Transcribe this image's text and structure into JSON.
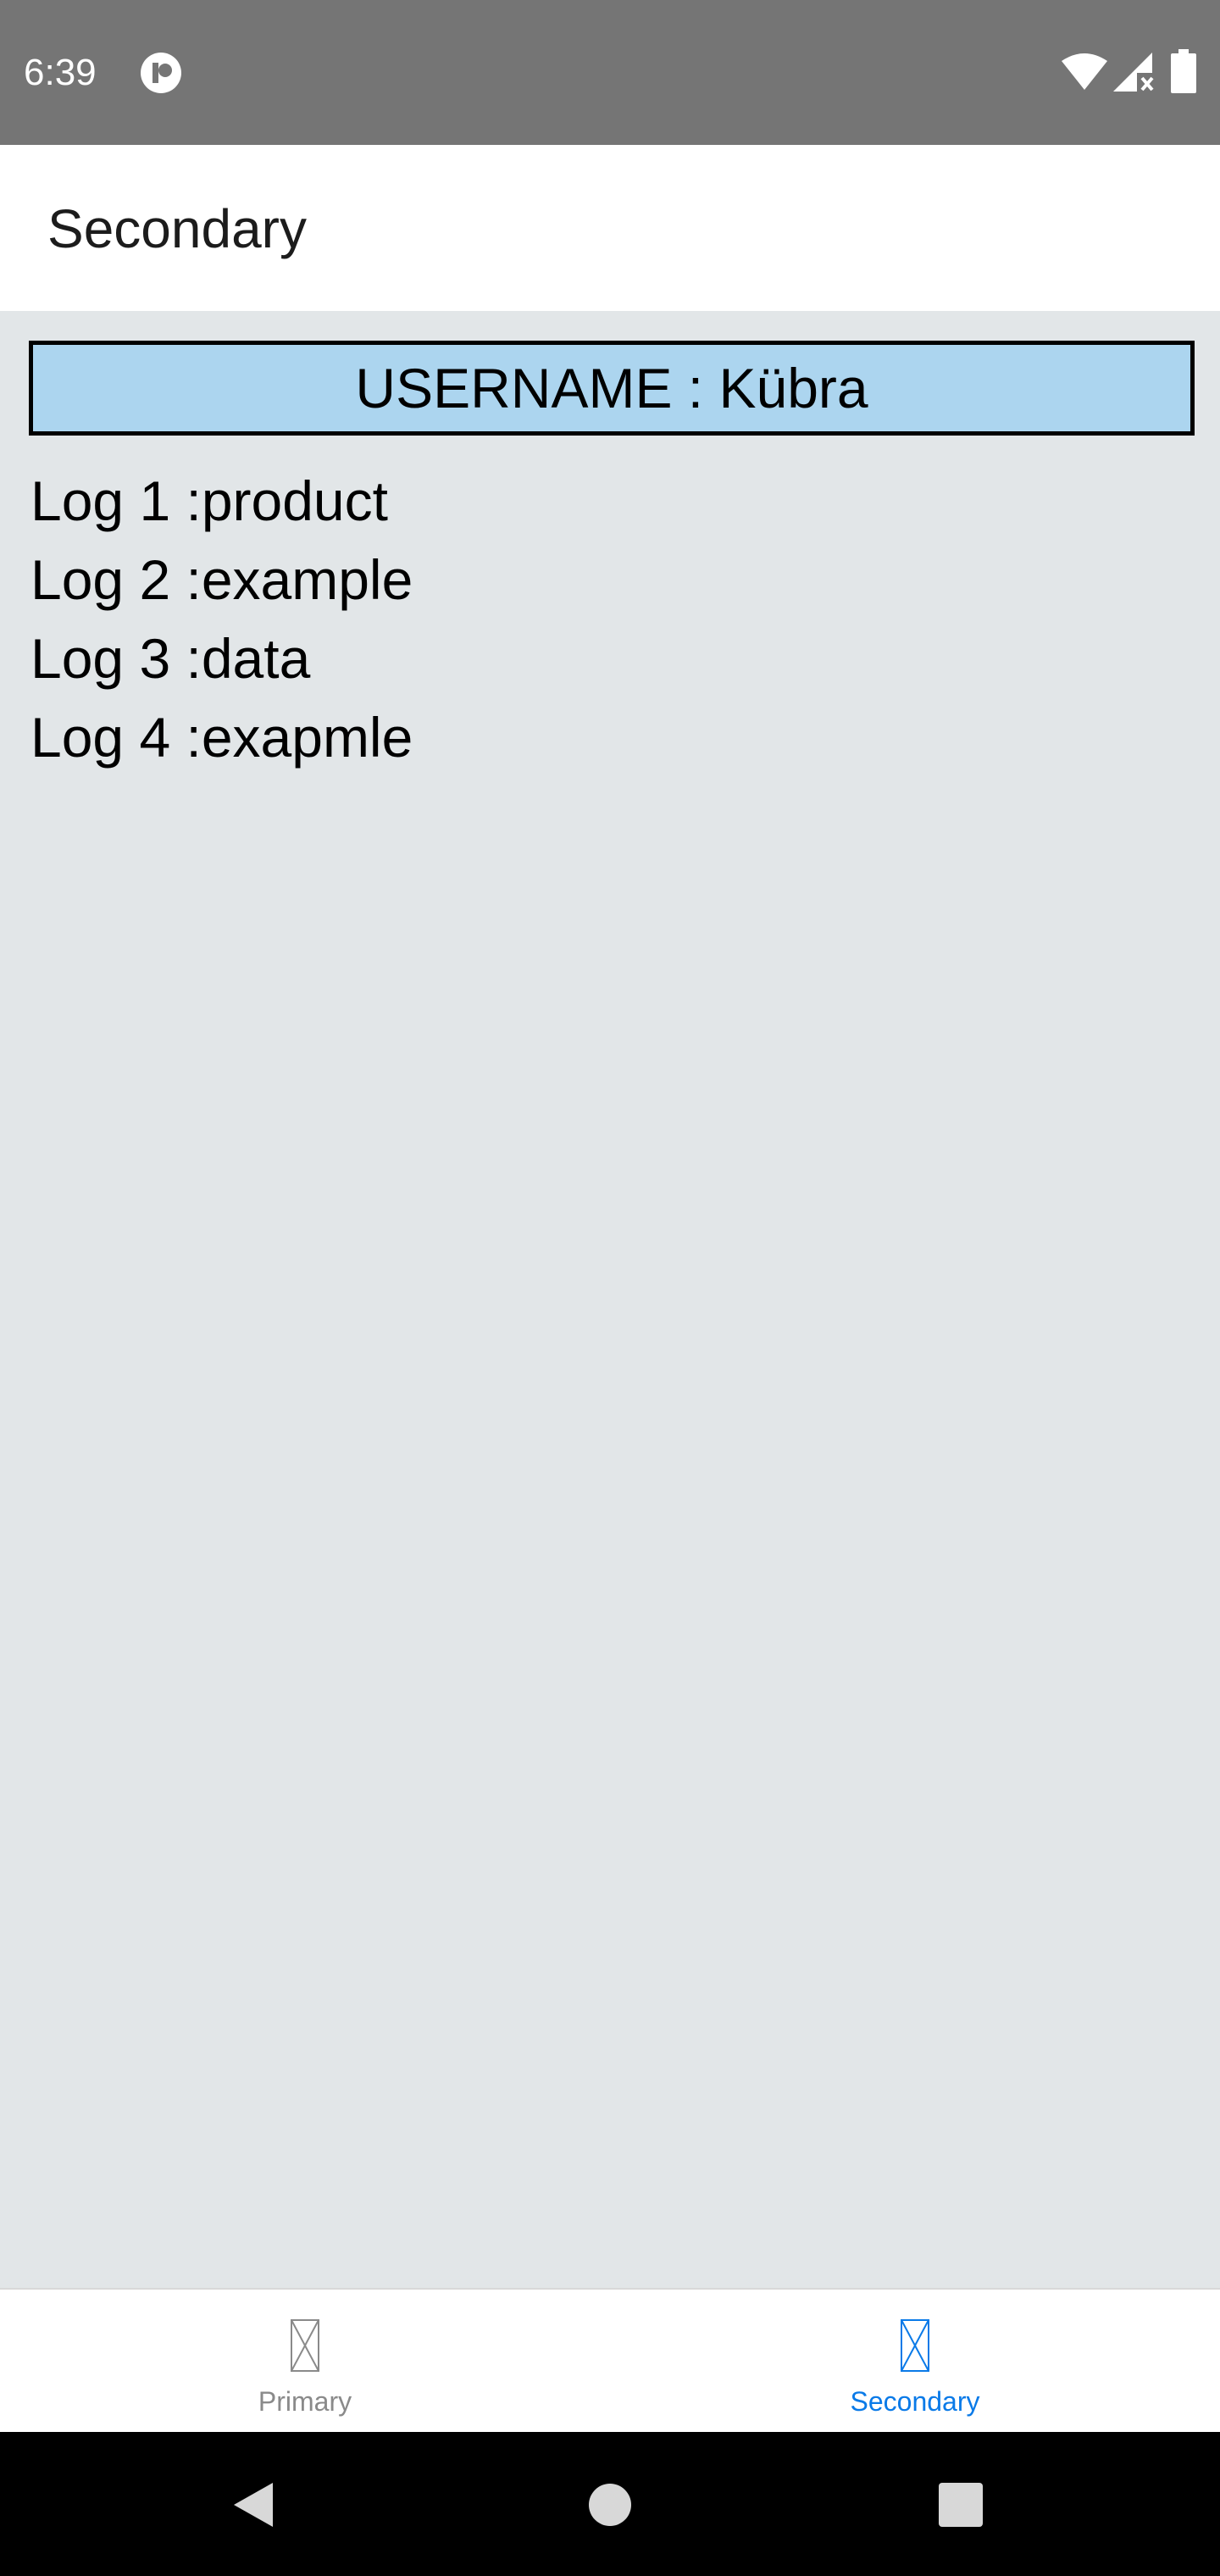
{
  "status_bar": {
    "time": "6:39",
    "icons": [
      "app-notification-icon",
      "wifi-icon",
      "cell-signal-icon",
      "battery-icon"
    ]
  },
  "app_bar": {
    "title": "Secondary"
  },
  "content": {
    "username_label": "USERNAME : Kübra",
    "logs": [
      "Log 1 :product",
      "Log 2 :example",
      "Log 3 :data",
      "Log 4 :exapmle"
    ]
  },
  "tabs": [
    {
      "label": "Primary",
      "icon": "missing-glyph-icon",
      "active": false
    },
    {
      "label": "Secondary",
      "icon": "missing-glyph-icon",
      "active": true
    }
  ],
  "nav_bar": {
    "icons": [
      "back-icon",
      "home-icon",
      "recents-icon"
    ]
  },
  "colors": {
    "status_bar_bg": "#757575",
    "content_bg": "#e2e6e8",
    "username_box_bg": "#acd5ef",
    "active_tab": "#0a7ae8",
    "inactive_tab": "#8a8a8a"
  }
}
